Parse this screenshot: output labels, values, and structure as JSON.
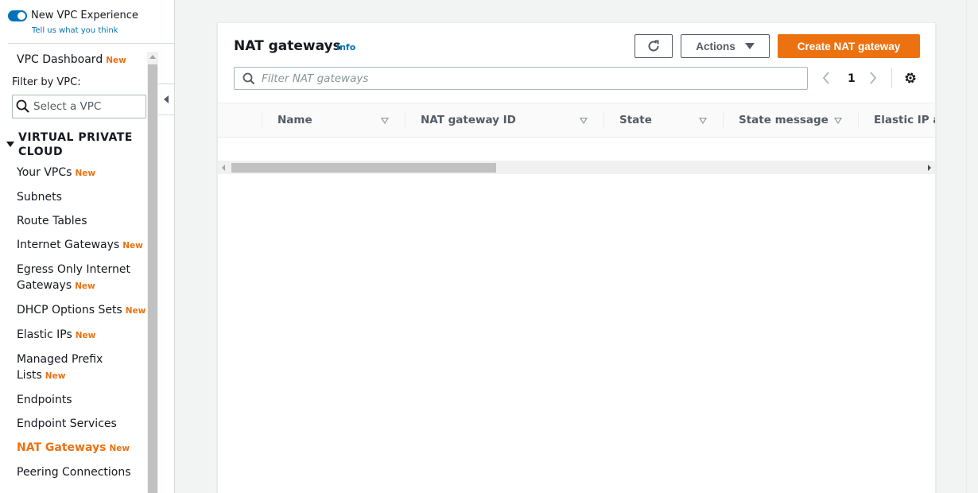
{
  "sidebar": {
    "experience_toggle": "New VPC Experience",
    "tell_us_link": "Tell us what you think",
    "filter_label": "Filter by VPC:",
    "vpc_select_placeholder": "Select a VPC",
    "section_header": "VIRTUAL PRIVATE CLOUD",
    "new_badge": "New",
    "dashboard": {
      "label": "VPC Dashboard",
      "new": true
    },
    "items": [
      {
        "label": "Your VPCs",
        "new": true
      },
      {
        "label": "Subnets",
        "new": false
      },
      {
        "label": "Route Tables",
        "new": false
      },
      {
        "label": "Internet Gateways",
        "new": true
      },
      {
        "label": "Egress Only Internet Gateways",
        "new": true
      },
      {
        "label": "DHCP Options Sets",
        "new": true
      },
      {
        "label": "Elastic IPs",
        "new": true
      },
      {
        "label": "Managed Prefix Lists",
        "new": true
      },
      {
        "label": "Endpoints",
        "new": false
      },
      {
        "label": "Endpoint Services",
        "new": false
      },
      {
        "label": "NAT Gateways",
        "new": true,
        "active": true
      },
      {
        "label": "Peering Connections",
        "new": false
      }
    ]
  },
  "panel": {
    "title": "NAT gateways",
    "info_link": "Info",
    "actions_label": "Actions",
    "create_label": "Create NAT gateway",
    "filter_placeholder": "Filter NAT gateways",
    "current_page": "1",
    "columns": [
      "Name",
      "NAT gateway ID",
      "State",
      "State message",
      "Elastic IP ad"
    ]
  },
  "colors": {
    "accent": "#ec7211",
    "link": "#0073bb"
  }
}
